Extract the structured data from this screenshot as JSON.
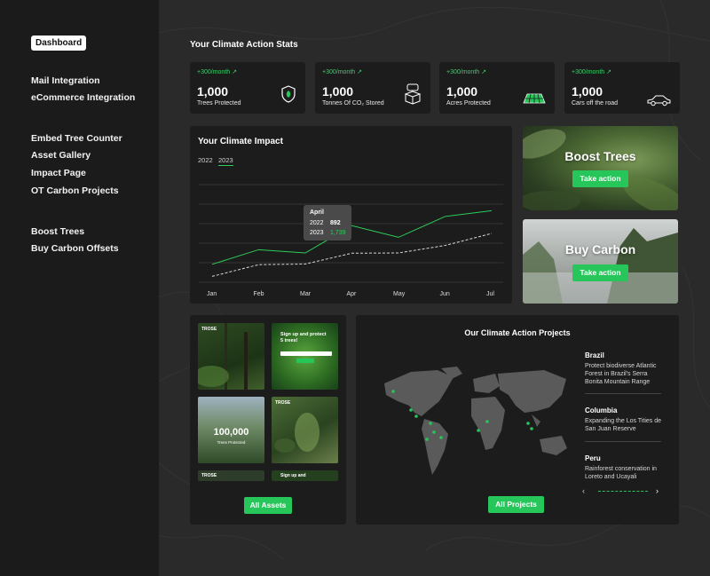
{
  "sidebar": {
    "active": "Dashboard",
    "items": [
      "Mail Integration",
      "eCommerce Integration",
      "Embed Tree Counter",
      "Asset Gallery",
      "Impact Page",
      "OT Carbon Projects",
      "Boost Trees",
      "Buy Carbon Offsets"
    ]
  },
  "stats": {
    "title": "Your Climate Action Stats",
    "cards": [
      {
        "change": "+300/month ↗",
        "value": "1,000",
        "label": "Trees Protected",
        "icon": "shield-leaf-icon"
      },
      {
        "change": "+300/month ↗",
        "value": "1,000",
        "label": "Tonnes Of CO₂ Stored",
        "icon": "co2-box-icon"
      },
      {
        "change": "+300/month ↗",
        "value": "1,000",
        "label": "Acres Protected",
        "icon": "land-grid-icon"
      },
      {
        "change": "+300/month ↗",
        "value": "1,000",
        "label": "Cars off the road",
        "icon": "car-icon"
      }
    ]
  },
  "impact": {
    "title": "Your Climate Impact",
    "years": [
      "2022",
      "2023"
    ],
    "tooltip": {
      "month": "April",
      "rows": [
        {
          "year": "2022",
          "value": "892"
        },
        {
          "year": "2023",
          "value": "1,739"
        }
      ]
    }
  },
  "chart_data": {
    "type": "line",
    "categories": [
      "Jan",
      "Feb",
      "Mar",
      "Apr",
      "May",
      "Jun",
      "Jul"
    ],
    "series": [
      {
        "name": "2022",
        "values": [
          180,
          540,
          560,
          892,
          900,
          1130,
          1500
        ],
        "style": "dashed",
        "color": "#d9d9d9"
      },
      {
        "name": "2023",
        "values": [
          550,
          1000,
          900,
          1739,
          1380,
          2020,
          2200
        ],
        "style": "solid",
        "color": "#2ecc5a"
      }
    ],
    "ylim": [
      0,
      3000
    ],
    "grid": true
  },
  "promos": [
    {
      "title": "Boost Trees",
      "button": "Take action"
    },
    {
      "title": "Buy Carbon",
      "button": "Take action"
    }
  ],
  "assets": {
    "button": "All Assets",
    "tiles": [
      {
        "brand": "TROSE"
      },
      {
        "headline": "Sign up and protect 5 trees!"
      },
      {
        "value": "100,000",
        "caption": "Trees Protected"
      },
      {
        "brand": "TROSE"
      },
      {
        "brand": "TROSE"
      },
      {
        "headline": "Sign up and"
      }
    ]
  },
  "projects": {
    "title": "Our Climate Action Projects",
    "button": "All Projects",
    "items": [
      {
        "name": "Brazil",
        "desc": "Protect biodiverse Atlantic Forest in Brazil's Serra Bonita Mountain Range"
      },
      {
        "name": "Columbia",
        "desc": "Expanding the Los Tities de San Juan Reserve"
      },
      {
        "name": "Peru",
        "desc": "Rainforest conservation in Loreto and Ucayali"
      }
    ]
  },
  "colors": {
    "accent": "#27c65a",
    "sidebar": "#1b1b1b",
    "card": "#1c1c1c",
    "main": "#2a2a2a"
  }
}
